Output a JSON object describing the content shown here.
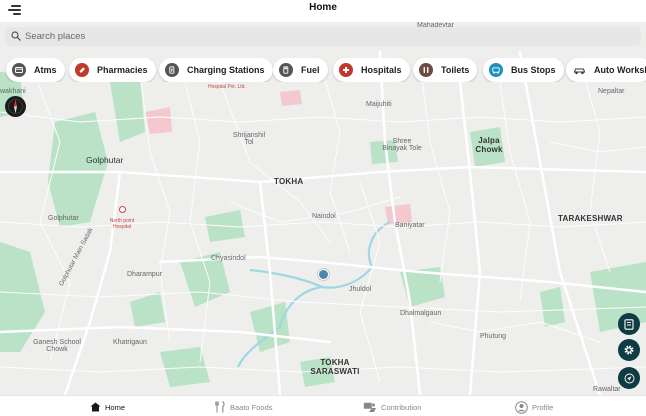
{
  "header": {
    "title": "Home"
  },
  "search": {
    "placeholder": "Search places"
  },
  "categories": [
    {
      "label": "Atms",
      "icon": "atm-icon",
      "color": "#555555"
    },
    {
      "label": "Pharmacies",
      "icon": "pharmacy-icon",
      "color": "#c0392b"
    },
    {
      "label": "Charging Stations",
      "icon": "charging-station-icon",
      "color": "#555555"
    },
    {
      "label": "Fuel",
      "icon": "fuel-icon",
      "color": "#555555"
    },
    {
      "label": "Hospitals",
      "icon": "hospital-icon",
      "color": "#c0392b"
    },
    {
      "label": "Toilets",
      "icon": "toilet-icon",
      "color": "#6d4c41"
    },
    {
      "label": "Bus Stops",
      "icon": "bus-stop-icon",
      "color": "#1f8fbf"
    },
    {
      "label": "Auto Worksh",
      "icon": "auto-workshop-icon",
      "color": "#333333"
    }
  ],
  "map": {
    "labels": {
      "mahadevtar": "Mahadevtar",
      "hospital_pvt": "Hospital Pvt. Ltd.",
      "nepaltar": "Nepaltar",
      "wakhani": "wakhani",
      "maijuhiti": "Maijuhiti",
      "shrijanshil_1": "Shrijanshil",
      "shrijanshil_2": "Tol",
      "shree_1": "Shree",
      "shree_2": "Binayak Tole",
      "jalpa_1": "Jalpa",
      "jalpa_2": "Chowk",
      "golphutar": "Golphutar",
      "tokha": "TOKHA",
      "golphutar_small": "Golphutar",
      "north_point_1": "North point",
      "north_point_2": "Hospital",
      "naindol": "Naindol",
      "baniyatar": "Baniyatar",
      "tarakeshwar": "TARAKESHWAR",
      "golphutar_main": "Golphutar Main Sadak",
      "chyasindol": "Chyasindol",
      "dharampur": "Dharampur",
      "jhuldol": "Jhuldol",
      "dhalmalgaun": "Dhalmalgaun",
      "ganesh_1": "Ganesh School",
      "ganesh_2": "Chowk",
      "khatrigaun": "Khatrigaun",
      "phutung": "Phutung",
      "tokha_saraswati_1": "TOKHA",
      "tokha_saraswati_2": "SARASWATI",
      "rawaltar": "Rawaltar"
    }
  },
  "nav": {
    "home": "Home",
    "baato_foods": "Baato Foods",
    "contribution": "Contribution",
    "profile": "Profile"
  },
  "colors": {
    "accent": "#0e3b44",
    "marker": "#4a87a8",
    "park": "#a8d8b9",
    "water": "#8fd3e0"
  }
}
